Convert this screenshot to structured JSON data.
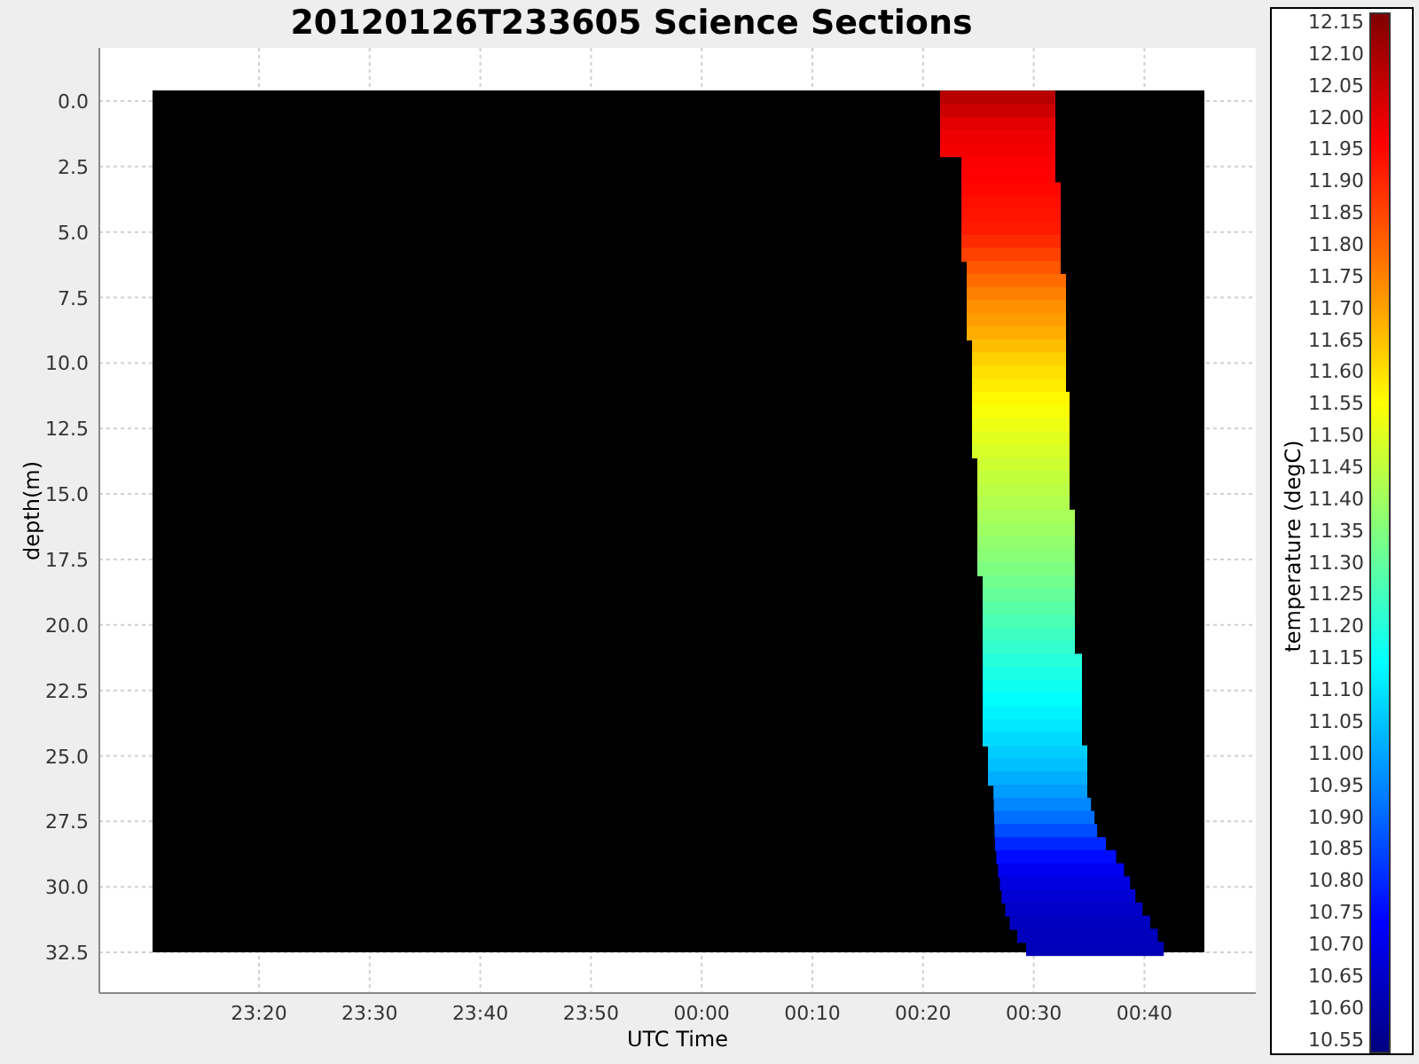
{
  "title": "20120126T233605 Science Sections",
  "y_axis": {
    "label": "depth(m)",
    "ticks": [
      "0.0",
      "2.5",
      "5.0",
      "7.5",
      "10.0",
      "12.5",
      "15.0",
      "17.5",
      "20.0",
      "22.5",
      "25.0",
      "27.5",
      "30.0",
      "32.5"
    ]
  },
  "x_axis": {
    "label": "UTC Time",
    "ticks": [
      "23:20",
      "23:30",
      "23:40",
      "23:50",
      "00:00",
      "00:10",
      "00:20",
      "00:30",
      "00:40"
    ]
  },
  "colorbar": {
    "label": "temperature (degC)",
    "ticks": [
      "12.15",
      "12.10",
      "12.05",
      "12.00",
      "11.95",
      "11.90",
      "11.85",
      "11.80",
      "11.75",
      "11.70",
      "11.65",
      "11.60",
      "11.55",
      "11.50",
      "11.45",
      "11.40",
      "11.35",
      "11.30",
      "11.25",
      "11.20",
      "11.15",
      "11.10",
      "11.05",
      "11.00",
      "10.95",
      "10.90",
      "10.85",
      "10.80",
      "10.75",
      "10.70",
      "10.65",
      "10.60",
      "10.55"
    ]
  }
}
